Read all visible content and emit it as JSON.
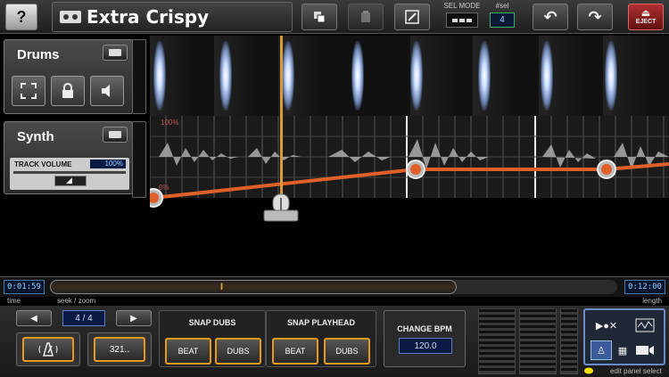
{
  "toolbar": {
    "help_label": "?",
    "project_title": "Extra Crispy",
    "sel_mode_label": "SEL MODE",
    "sel_count_label": "#sel",
    "sel_count_value": "4",
    "eject_label": "EJECT"
  },
  "tracks": [
    {
      "name": "Drums"
    },
    {
      "name": "Synth",
      "volume_label": "TRACK VOLUME",
      "volume_value": "100%"
    }
  ],
  "lane_labels": {
    "top": "100%",
    "bottom": "0%"
  },
  "scrub": {
    "current_time": "0:01:59",
    "length_time": "0:12:00",
    "time_label": "time",
    "seek_label": "seek / zoom",
    "length_label": "length"
  },
  "bottom": {
    "time_signature": "4 / 4",
    "count_in_label": "321..",
    "snap_dubs_title": "SNAP DUBS",
    "snap_playhead_title": "SNAP PLAYHEAD",
    "beat_label": "BEAT",
    "dubs_label": "DUBS",
    "bpm_label": "CHANGE BPM",
    "bpm_value": "120.0",
    "edit_panel_label": "edit panel select"
  },
  "colors": {
    "accent": "#e89a1c",
    "envelope": "#e0602a",
    "display_bg": "#0a1a44"
  },
  "icons": [
    "help-icon",
    "cassette-icon",
    "copy-icon",
    "paste-icon",
    "edit-icon",
    "undo-icon",
    "redo-icon",
    "eject-icon",
    "expand-icon",
    "lock-icon",
    "speaker-icon",
    "metronome-icon",
    "wave-icon",
    "video-icon"
  ]
}
